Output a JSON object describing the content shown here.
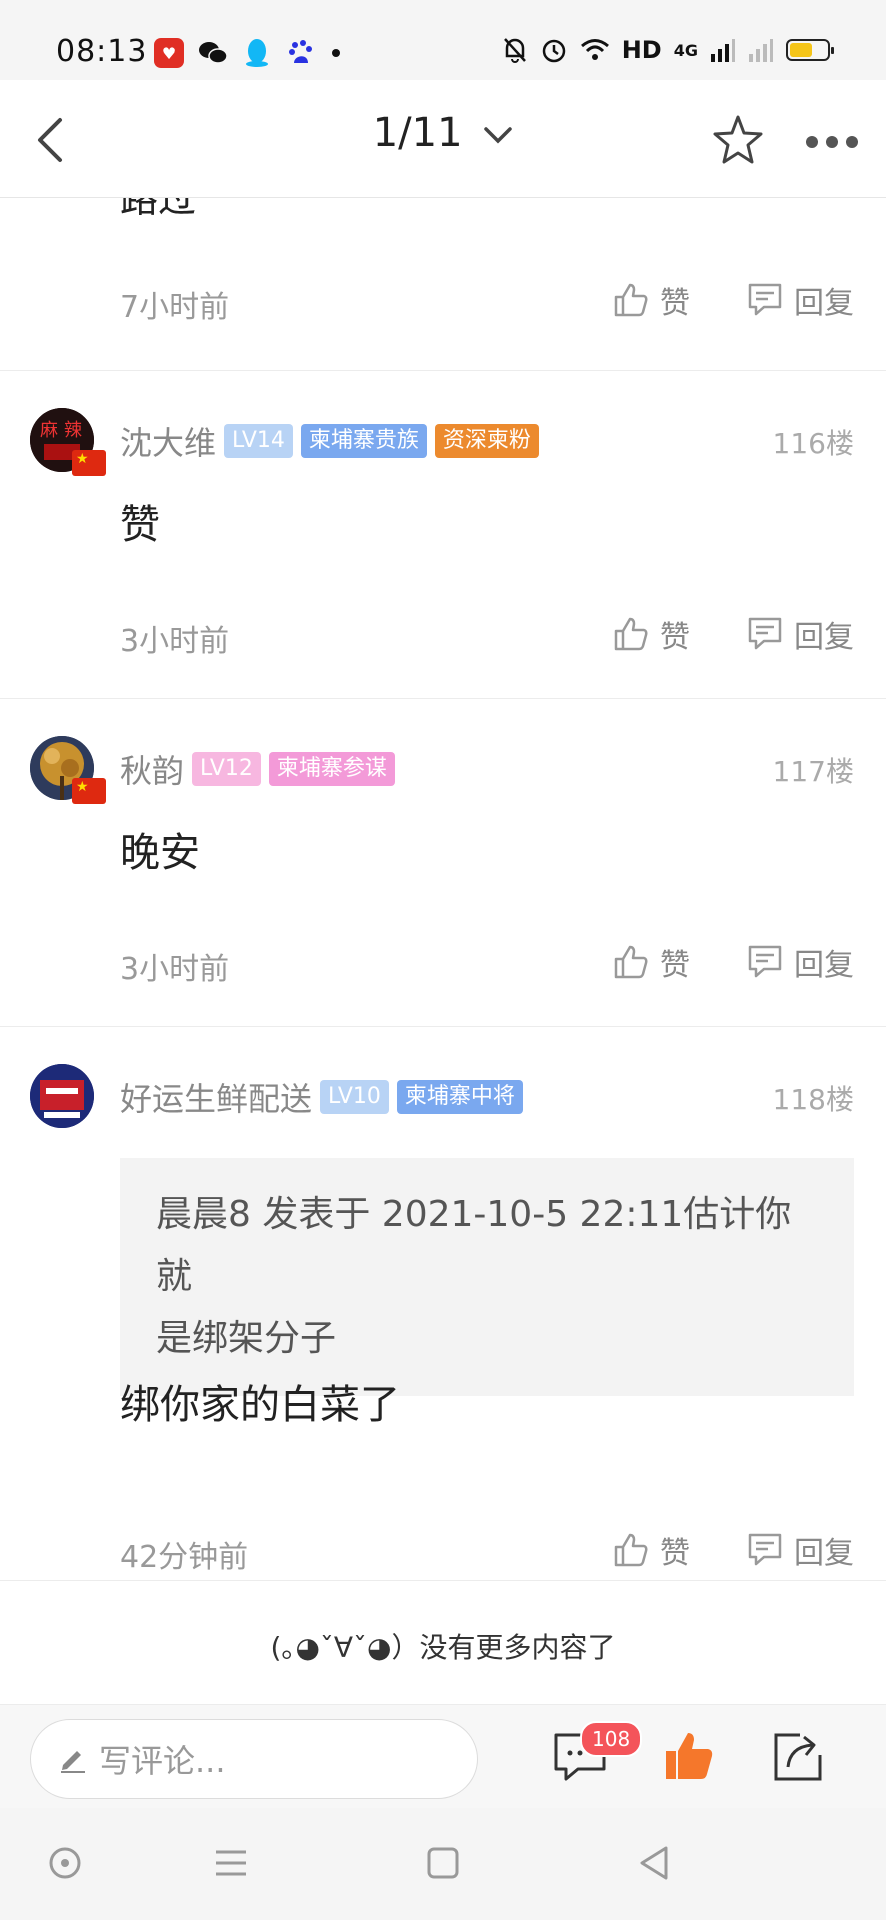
{
  "status_bar": {
    "time": "08:13",
    "hd": "HD",
    "net": "4G",
    "icons": [
      "pinduoduo-icon",
      "wechat-icon",
      "qq-icon",
      "baidu-icon",
      "mute-icon",
      "alarm-icon",
      "wifi-icon",
      "signal-icon",
      "battery-icon"
    ]
  },
  "nav": {
    "page_indicator": "1/11"
  },
  "partial_post": {
    "text_fragment": "路过",
    "time": "7小时前",
    "like_label": "赞",
    "reply_label": "回复"
  },
  "posts": [
    {
      "username": "沈大维",
      "level": "LV14",
      "tags": [
        "柬埔寨贵族",
        "资深柬粉"
      ],
      "floor": "116楼",
      "content": "赞",
      "time": "3小时前",
      "like_label": "赞",
      "reply_label": "回复"
    },
    {
      "username": "秋韵",
      "level": "LV12",
      "tags": [
        "柬埔寨参谋"
      ],
      "floor": "117楼",
      "content": "晚安",
      "time": "3小时前",
      "like_label": "赞",
      "reply_label": "回复"
    },
    {
      "username": "好运生鲜配送",
      "level": "LV10",
      "tags": [
        "柬埔寨中将"
      ],
      "floor": "118楼",
      "quote_line1": "晨晨8 发表于 2021-10-5 22:11估计你就",
      "quote_line2": "是绑架分子",
      "content": "绑你家的白菜了",
      "time": "42分钟前",
      "like_label": "赞",
      "reply_label": "回复"
    }
  ],
  "end_message": "(｡◕ˇ∀ˇ◕）没有更多内容了",
  "comment_bar": {
    "placeholder": "写评论...",
    "comment_count": "108"
  },
  "colors": {
    "accent_orange": "#f5772b",
    "badge_red": "#f4545a"
  }
}
